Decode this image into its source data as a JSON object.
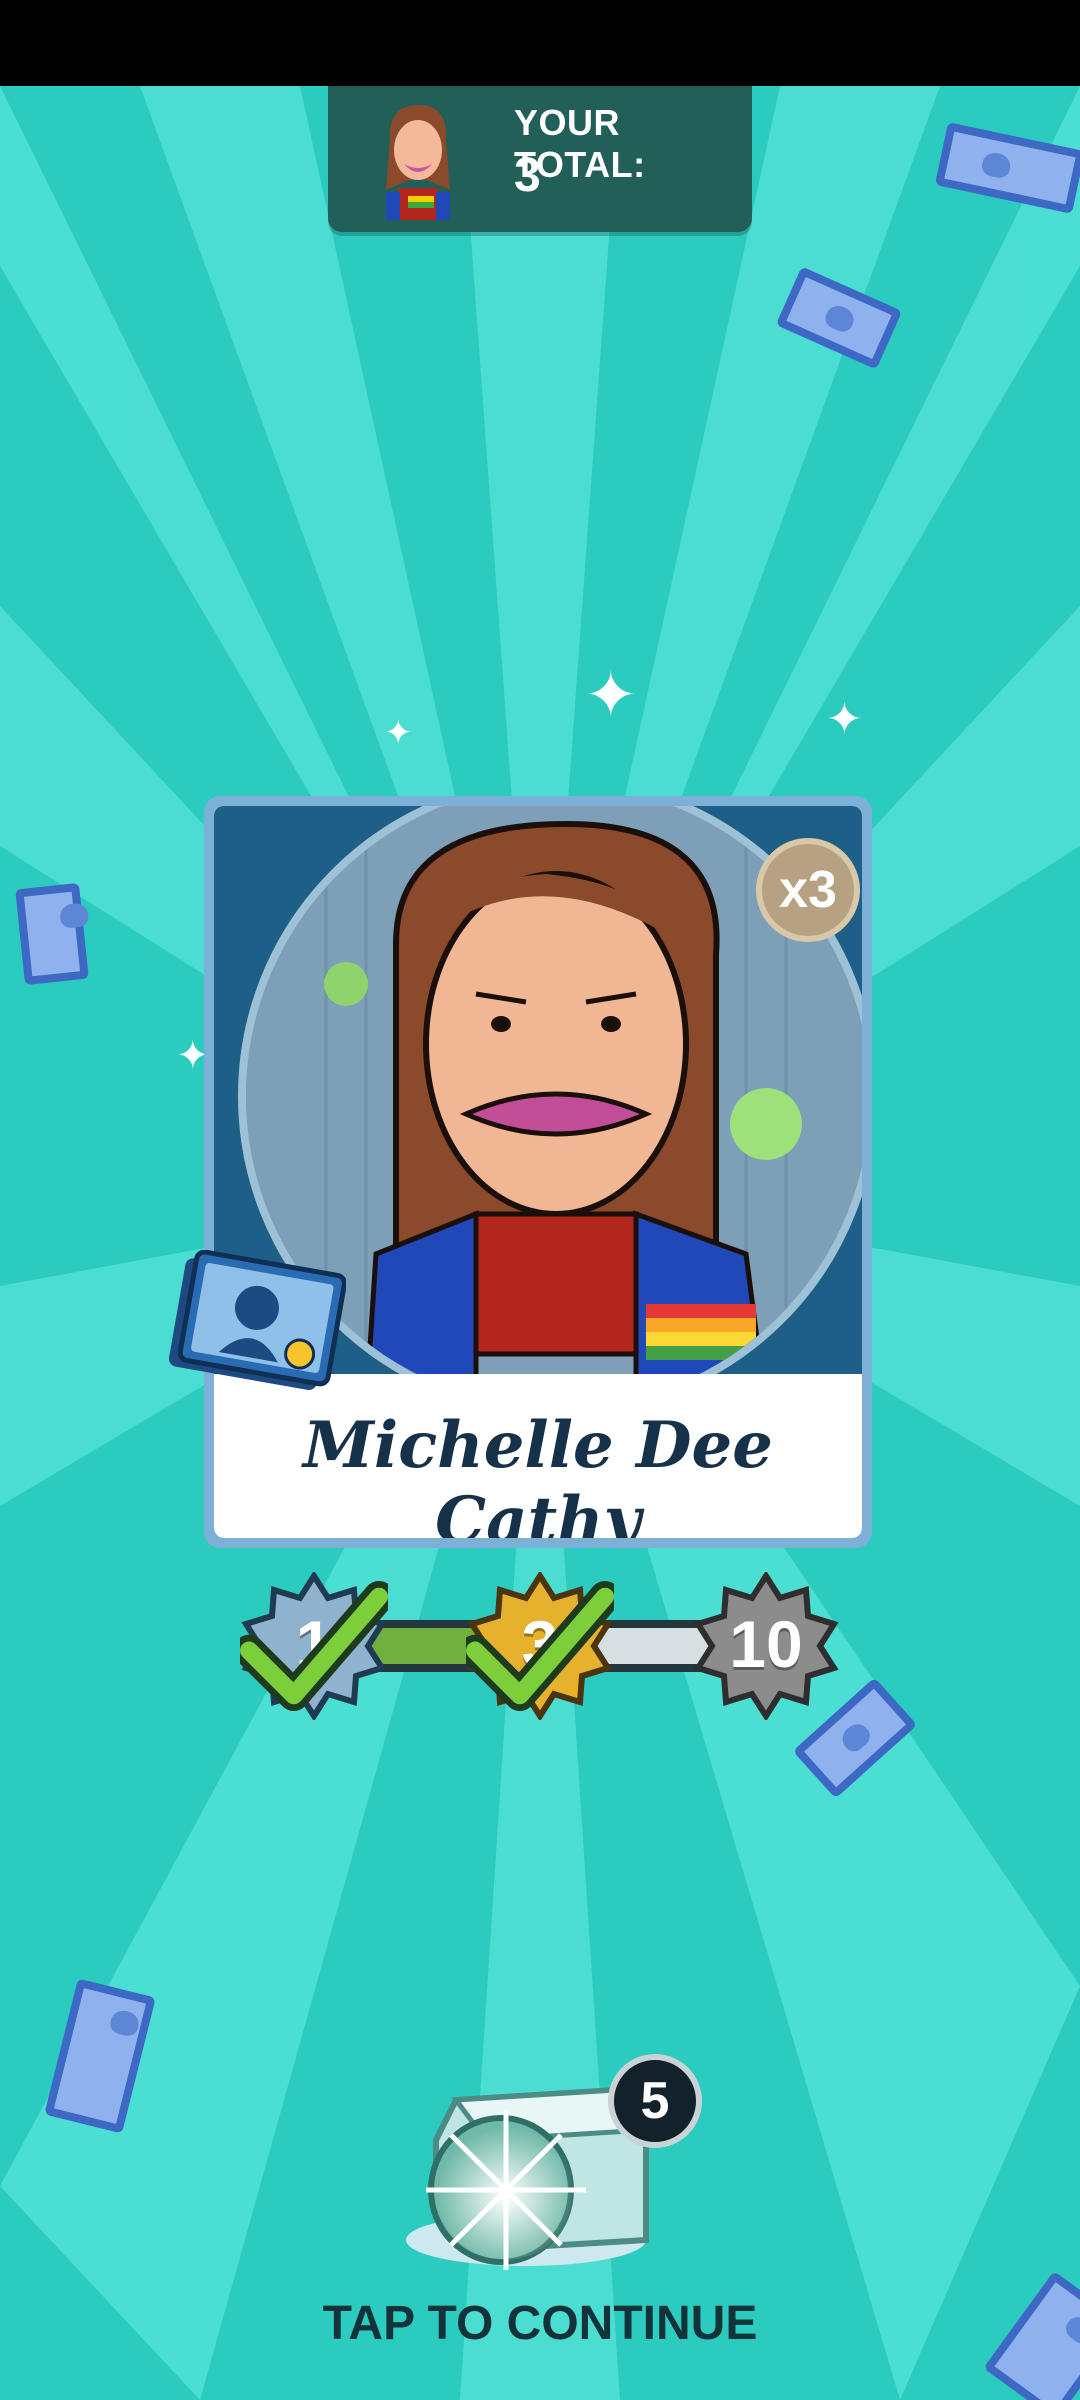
{
  "total": {
    "label": "YOUR TOTAL:",
    "value": "3"
  },
  "card": {
    "name": "Michelle Dee Cathy",
    "count_badge": "x3"
  },
  "progress": {
    "milestones": [
      {
        "label": "1",
        "reached": true,
        "color": "#8fb3cf"
      },
      {
        "label": "3",
        "reached": true,
        "color": "#e6b12c"
      },
      {
        "label": "10",
        "reached": false,
        "color": "#8c8c8c"
      }
    ],
    "fill_fraction": 0.55
  },
  "chest": {
    "badge_count": "5"
  },
  "prompt": {
    "tap_to_continue": "TAP TO CONTINUE"
  },
  "colors": {
    "background": "#34d3c8",
    "panel": "#215f58",
    "name_text": "#16324a"
  }
}
